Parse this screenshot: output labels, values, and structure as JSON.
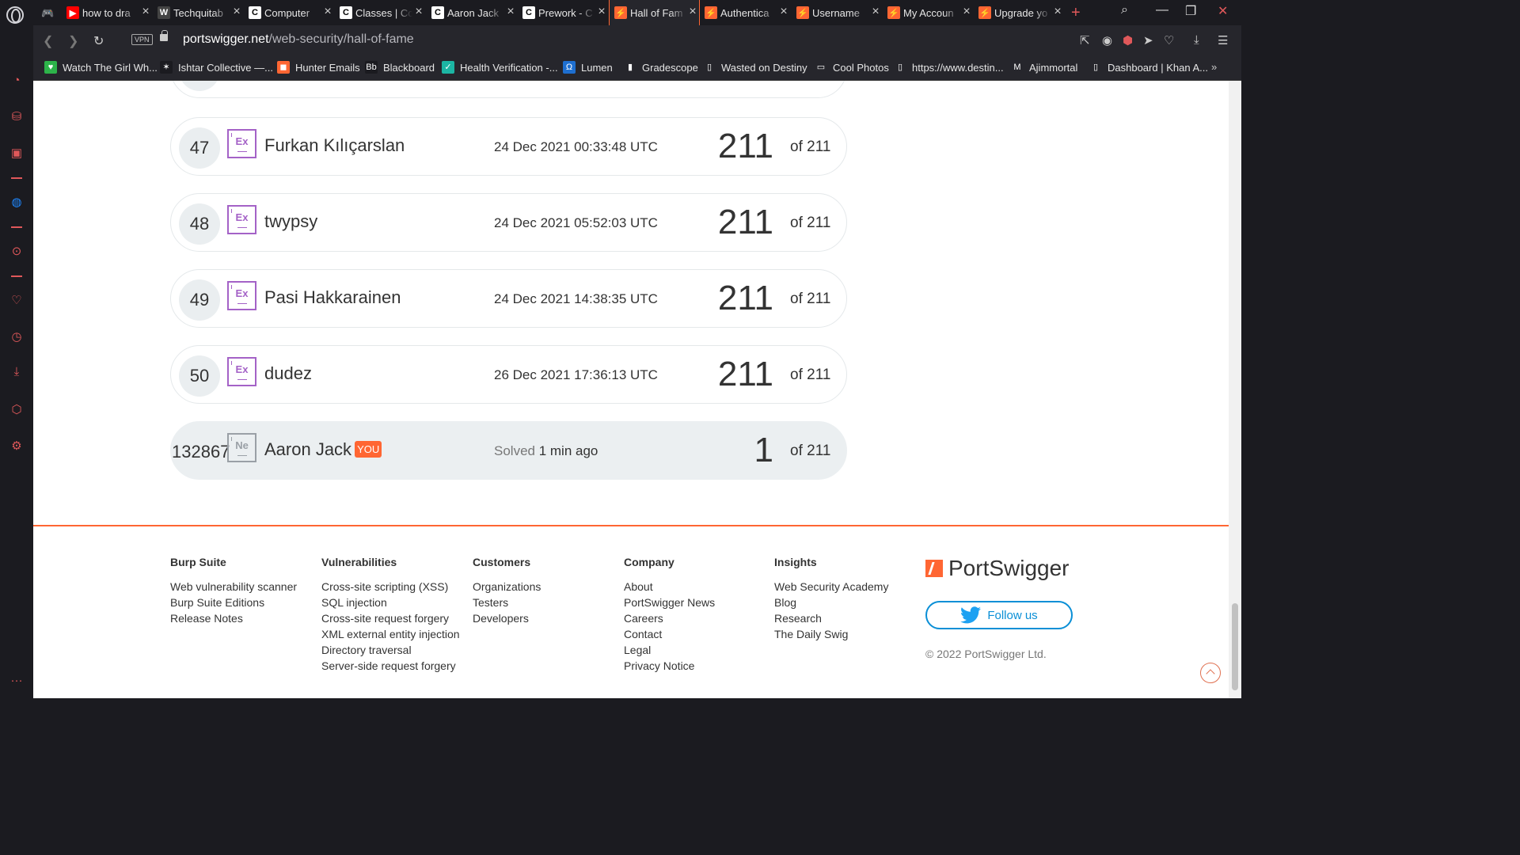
{
  "browser": {
    "tabs": [
      {
        "title": "how to dra",
        "fav": "▶",
        "color": "#ff0000"
      },
      {
        "title": "Techquitab",
        "fav": "W",
        "color": "#444444"
      },
      {
        "title": "Computer",
        "fav": "C",
        "color": "#ffffff"
      },
      {
        "title": "Classes | Co",
        "fav": "C",
        "color": "#ffffff"
      },
      {
        "title": "Aaron Jack",
        "fav": "C",
        "color": "#ffffff"
      },
      {
        "title": "Prework - C",
        "fav": "C",
        "color": "#ffffff"
      },
      {
        "title": "Hall of Fam",
        "fav": "⚡",
        "color": "#ff6633"
      },
      {
        "title": "Authentica",
        "fav": "⚡",
        "color": "#ff6633"
      },
      {
        "title": "Username",
        "fav": "⚡",
        "color": "#ff6633"
      },
      {
        "title": "My Accoun",
        "fav": "⚡",
        "color": "#ff6633"
      },
      {
        "title": "Upgrade yo",
        "fav": "⚡",
        "color": "#ff6633"
      }
    ],
    "url_host": "portswigger.net",
    "url_path": "/web-security/hall-of-fame",
    "vpn_label": "VPN",
    "bookmarks": [
      {
        "label": "Watch The Girl Wh...",
        "fav": "♥",
        "color": "#2db34a"
      },
      {
        "label": "Ishtar Collective —...",
        "fav": "✶",
        "color": "#1b1b20"
      },
      {
        "label": "Hunter Emails",
        "fav": "◼",
        "color": "#ff6633"
      },
      {
        "label": "Blackboard",
        "fav": "Bb",
        "color": "#1b1b20"
      },
      {
        "label": "Health Verification -...",
        "fav": "✓",
        "color": "#1cb5a3"
      },
      {
        "label": "Lumen",
        "fav": "Ω",
        "color": "#1e6fd0"
      },
      {
        "label": "Gradescope",
        "fav": "▮",
        "color": "#26262c"
      },
      {
        "label": "Wasted on Destiny",
        "fav": "▯",
        "color": "#26262c"
      },
      {
        "label": "Cool Photos",
        "fav": "▭",
        "color": "#26262c"
      },
      {
        "label": "https://www.destin...",
        "fav": "▯",
        "color": "#26262c"
      },
      {
        "label": "Ajimmortal",
        "fav": "M",
        "color": "#26262c"
      },
      {
        "label": "Dashboard | Khan A...",
        "fav": "▯",
        "color": "#26262c"
      }
    ]
  },
  "hall_of_fame": {
    "rows": [
      {
        "rank": "47",
        "badge": "Ex",
        "name": "Furkan Kılıçarslan",
        "date": "24 Dec 2021 00:33:48 UTC",
        "solved": "211",
        "total": "of 211"
      },
      {
        "rank": "48",
        "badge": "Ex",
        "name": "twypsy",
        "date": "24 Dec 2021 05:52:03 UTC",
        "solved": "211",
        "total": "of 211"
      },
      {
        "rank": "49",
        "badge": "Ex",
        "name": "Pasi Hakkarainen",
        "date": "24 Dec 2021 14:38:35 UTC",
        "solved": "211",
        "total": "of 211"
      },
      {
        "rank": "50",
        "badge": "Ex",
        "name": "dudez",
        "date": "26 Dec 2021 17:36:13 UTC",
        "solved": "211",
        "total": "of 211"
      }
    ],
    "you": {
      "rank": "132867",
      "badge": "Ne",
      "name": "Aaron Jack",
      "tag": "YOU",
      "solved_label": "Solved",
      "solved_when": "1 min ago",
      "solved": "1",
      "total": "of 211"
    }
  },
  "footer": {
    "burp": {
      "heading": "Burp Suite",
      "links": [
        "Web vulnerability scanner",
        "Burp Suite Editions",
        "Release Notes"
      ]
    },
    "vulns": {
      "heading": "Vulnerabilities",
      "links": [
        "Cross-site scripting (XSS)",
        "SQL injection",
        "Cross-site request forgery",
        "XML external entity injection",
        "Directory traversal",
        "Server-side request forgery"
      ]
    },
    "customers": {
      "heading": "Customers",
      "links": [
        "Organizations",
        "Testers",
        "Developers"
      ]
    },
    "company": {
      "heading": "Company",
      "links": [
        "About",
        "PortSwigger News",
        "Careers",
        "Contact",
        "Legal",
        "Privacy Notice"
      ]
    },
    "insights": {
      "heading": "Insights",
      "links": [
        "Web Security Academy",
        "Blog",
        "Research",
        "The Daily Swig"
      ]
    },
    "brand": "PortSwigger",
    "follow_label": "Follow us",
    "copyright": "© 2022 PortSwigger Ltd."
  }
}
